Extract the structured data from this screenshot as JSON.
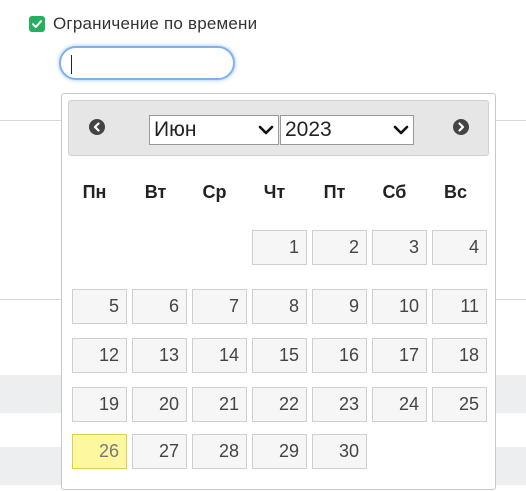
{
  "form": {
    "time_limit_label": "Ограничение по времени",
    "time_limit_checked": true,
    "time_input_value": ""
  },
  "datepicker": {
    "selected_month": "Июн",
    "selected_year": "2023",
    "weekdays": [
      "Пн",
      "Вт",
      "Ср",
      "Чт",
      "Пт",
      "Сб",
      "Вс"
    ],
    "weeks": [
      [
        "",
        "",
        "",
        "1",
        "2",
        "3",
        "4"
      ],
      [
        "5",
        "6",
        "7",
        "8",
        "9",
        "10",
        "11"
      ],
      [
        "12",
        "13",
        "14",
        "15",
        "16",
        "17",
        "18"
      ],
      [
        "19",
        "20",
        "21",
        "22",
        "23",
        "24",
        "25"
      ],
      [
        "26",
        "27",
        "28",
        "29",
        "30",
        "",
        ""
      ]
    ],
    "highlighted_day": "26"
  },
  "colors": {
    "checkbox": "#27ae60",
    "input_focus": "#7fb2ec",
    "today_highlight": "#fdf7a0"
  },
  "icons": {
    "prev": "circle-arrow-left-icon",
    "next": "circle-arrow-right-icon",
    "check": "checkmark-icon",
    "dropdown": "chevron-down-icon"
  }
}
